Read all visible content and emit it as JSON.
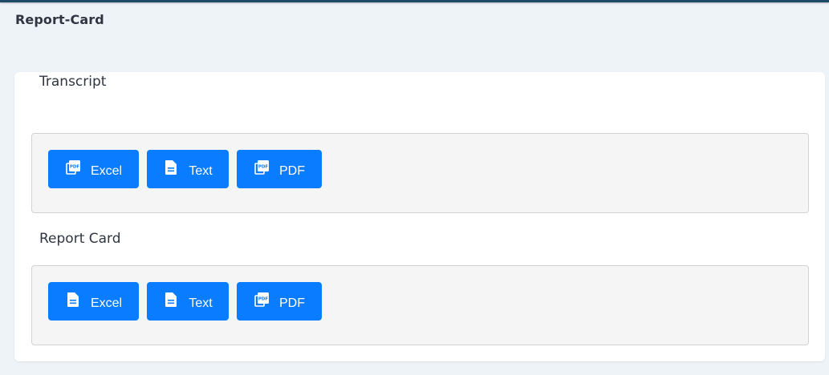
{
  "header": {
    "title": "Report-Card"
  },
  "sections": [
    {
      "title": "Transcript",
      "buttons": [
        {
          "label": "Excel",
          "icon": "pdf-icon"
        },
        {
          "label": "Text",
          "icon": "document-icon"
        },
        {
          "label": "PDF",
          "icon": "pdf-icon"
        }
      ]
    },
    {
      "title": "Report Card",
      "buttons": [
        {
          "label": "Excel",
          "icon": "document-icon"
        },
        {
          "label": "Text",
          "icon": "document-icon"
        },
        {
          "label": "PDF",
          "icon": "pdf-icon"
        }
      ]
    }
  ],
  "colors": {
    "button": "#0a7cff",
    "page_bg": "#eef3f7",
    "panel_bg": "#f5f5f5",
    "topbar": "#1f4a67"
  }
}
